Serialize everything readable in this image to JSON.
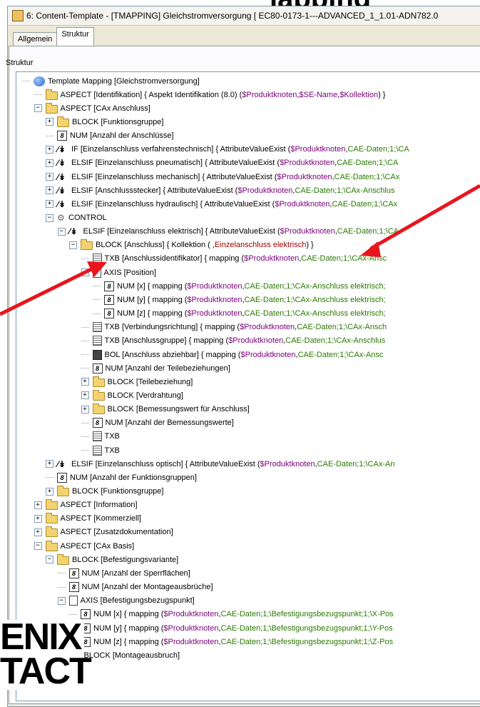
{
  "heading": "lapping",
  "window": {
    "title": "6: Content-Template - [TMAPPING] Gleichstromversorgung [ EC80-0173-1---ADVANCED_1_1.01-ADN782.0"
  },
  "tabs": [
    {
      "label": "Allgemein",
      "active": false
    },
    {
      "label": "Struktur",
      "active": true
    }
  ],
  "panel_label": "Struktur",
  "tree": [
    {
      "depth": 0,
      "exp": "",
      "icon": "tm",
      "icon_name": "template-mapping-icon",
      "text": "Template Mapping [Gleichstromversorgung]",
      "parts": []
    },
    {
      "depth": 1,
      "exp": "",
      "icon": "folder",
      "icon_name": "aspect-folder-icon",
      "text": "ASPECT [Identifikation] { Aspekt Identifikation (8.0) ( ",
      "parts": [
        [
          "$Produktknoten",
          "p"
        ],
        [
          ", ",
          "k"
        ],
        [
          "$SE-Name",
          "p"
        ],
        [
          ", ",
          "k"
        ],
        [
          "$Kollektion",
          "p"
        ],
        [
          " ) }",
          "k"
        ]
      ]
    },
    {
      "depth": 1,
      "exp": "−",
      "icon": "folder",
      "icon_name": "aspect-folder-icon",
      "text": "ASPECT [CAx Anschluss]",
      "parts": []
    },
    {
      "depth": 2,
      "exp": "+",
      "icon": "folder",
      "icon_name": "block-folder-icon",
      "text": "BLOCK [Funktionsgruppe]",
      "parts": []
    },
    {
      "depth": 2,
      "exp": "",
      "icon": "num",
      "icon_name": "num-icon",
      "text": "NUM [Anzahl der Anschlüsse]",
      "parts": []
    },
    {
      "depth": 2,
      "exp": "+",
      "icon": "cond",
      "icon_name": "condition-icon",
      "text": "IF [Einzelanschluss verfahrenstechnisch] { AttributeValueExist ( ",
      "parts": [
        [
          "$Produktknoten",
          "p"
        ],
        [
          ", ",
          "k"
        ],
        [
          "CAE-Daten;1;\\CA",
          "g"
        ]
      ]
    },
    {
      "depth": 2,
      "exp": "+",
      "icon": "cond",
      "icon_name": "condition-icon",
      "text": "ELSIF [Einzelanschluss pneumatisch] { AttributeValueExist ( ",
      "parts": [
        [
          "$Produktknoten",
          "p"
        ],
        [
          ", ",
          "k"
        ],
        [
          "CAE-Daten;1;\\CA",
          "g"
        ]
      ]
    },
    {
      "depth": 2,
      "exp": "+",
      "icon": "cond",
      "icon_name": "condition-icon",
      "text": "ELSIF [Einzelanschluss mechanisch] { AttributeValueExist ( ",
      "parts": [
        [
          "$Produktknoten",
          "p"
        ],
        [
          ", ",
          "k"
        ],
        [
          "CAE-Daten;1;\\CAx",
          "g"
        ]
      ]
    },
    {
      "depth": 2,
      "exp": "+",
      "icon": "cond",
      "icon_name": "condition-icon",
      "text": "ELSIF [Anschlussstecker] { AttributeValueExist ( ",
      "parts": [
        [
          "$Produktknoten",
          "p"
        ],
        [
          ", ",
          "k"
        ],
        [
          "CAE-Daten;1;\\CAx-Anschlus",
          "g"
        ]
      ]
    },
    {
      "depth": 2,
      "exp": "+",
      "icon": "cond",
      "icon_name": "condition-icon",
      "text": "ELSIF [Einzelanschluss hydraulisch] { AttributeValueExist ( ",
      "parts": [
        [
          "$Produktknoten",
          "p"
        ],
        [
          ", ",
          "k"
        ],
        [
          "CAE-Daten;1;\\CAx",
          "g"
        ]
      ]
    },
    {
      "depth": 2,
      "exp": "−",
      "icon": "control",
      "icon_name": "control-icon",
      "text": "CONTROL",
      "parts": []
    },
    {
      "depth": 3,
      "exp": "−",
      "icon": "cond",
      "icon_name": "condition-icon",
      "text": "ELSIF [Einzelanschluss elektrisch] { AttributeValueExist ( ",
      "parts": [
        [
          "$Produktknoten",
          "p"
        ],
        [
          ", ",
          "k"
        ],
        [
          "CAE-Daten;1;\\CA",
          "g"
        ]
      ]
    },
    {
      "depth": 4,
      "exp": "−",
      "icon": "folder",
      "icon_name": "block-folder-icon",
      "text": "BLOCK [Anschluss] { Kollektion ( , ",
      "parts": [
        [
          "Einzelanschluss elektrisch",
          "r"
        ],
        [
          " ) }",
          "k"
        ]
      ]
    },
    {
      "depth": 5,
      "exp": "",
      "icon": "txb",
      "icon_name": "txb-icon",
      "text": "TXB [Anschlussidentifikator] { mapping ( ",
      "parts": [
        [
          "$Produktknoten",
          "p"
        ],
        [
          ", ",
          "k"
        ],
        [
          "CAE-Daten;1;\\CAx-Ansc",
          "g"
        ]
      ]
    },
    {
      "depth": 5,
      "exp": "−",
      "icon": "axis",
      "icon_name": "axis-icon",
      "text": "AXIS [Position]",
      "parts": []
    },
    {
      "depth": 6,
      "exp": "",
      "icon": "num",
      "icon_name": "num-icon",
      "text": "NUM [x] { mapping ( ",
      "parts": [
        [
          "$Produktknoten",
          "p"
        ],
        [
          ", ",
          "k"
        ],
        [
          "CAE-Daten;1;\\CAx-Anschluss elektrisch;",
          "g"
        ]
      ]
    },
    {
      "depth": 6,
      "exp": "",
      "icon": "num",
      "icon_name": "num-icon",
      "text": "NUM [y] { mapping ( ",
      "parts": [
        [
          "$Produktknoten",
          "p"
        ],
        [
          ", ",
          "k"
        ],
        [
          "CAE-Daten;1;\\CAx-Anschluss elektrisch;",
          "g"
        ]
      ]
    },
    {
      "depth": 6,
      "exp": "",
      "icon": "num",
      "icon_name": "num-icon",
      "text": "NUM [z] { mapping ( ",
      "parts": [
        [
          "$Produktknoten",
          "p"
        ],
        [
          ", ",
          "k"
        ],
        [
          "CAE-Daten;1;\\CAx-Anschluss elektrisch;",
          "g"
        ]
      ]
    },
    {
      "depth": 5,
      "exp": "",
      "icon": "txb",
      "icon_name": "txb-icon",
      "text": "TXB [Verbindungsrichtung] { mapping ( ",
      "parts": [
        [
          "$Produktknoten",
          "p"
        ],
        [
          ", ",
          "k"
        ],
        [
          "CAE-Daten;1;\\CAx-Ansch",
          "g"
        ]
      ]
    },
    {
      "depth": 5,
      "exp": "",
      "icon": "txb",
      "icon_name": "txb-icon",
      "text": "TXB [Anschlussgruppe] { mapping ( ",
      "parts": [
        [
          "$Produktknoten",
          "p"
        ],
        [
          ", ",
          "k"
        ],
        [
          "CAE-Daten;1;\\CAx-Anschlus",
          "g"
        ]
      ]
    },
    {
      "depth": 5,
      "exp": "",
      "icon": "bol",
      "icon_name": "bol-icon",
      "text": "BOL [Anschluss abziehbar] { mapping ( ",
      "parts": [
        [
          "$Produktknoten",
          "p"
        ],
        [
          ", ",
          "k"
        ],
        [
          "CAE-Daten;1;\\CAx-Ansc",
          "g"
        ]
      ]
    },
    {
      "depth": 5,
      "exp": "",
      "icon": "num",
      "icon_name": "num-icon",
      "text": "NUM [Anzahl der Teilebeziehungen]",
      "parts": []
    },
    {
      "depth": 5,
      "exp": "+",
      "icon": "folder",
      "icon_name": "block-folder-icon",
      "text": "BLOCK [Teilebeziehung]",
      "parts": []
    },
    {
      "depth": 5,
      "exp": "+",
      "icon": "folder",
      "icon_name": "block-folder-icon",
      "text": "BLOCK [Verdrahtung]",
      "parts": []
    },
    {
      "depth": 5,
      "exp": "+",
      "icon": "folder",
      "icon_name": "block-folder-icon",
      "text": "BLOCK [Bemessungswert für Anschluss]",
      "parts": []
    },
    {
      "depth": 5,
      "exp": "",
      "icon": "num",
      "icon_name": "num-icon",
      "text": "NUM [Anzahl der Bemessungswerte]",
      "parts": []
    },
    {
      "depth": 5,
      "exp": "",
      "icon": "txb",
      "icon_name": "txb-icon",
      "text": "TXB",
      "parts": []
    },
    {
      "depth": 5,
      "exp": "",
      "icon": "txb",
      "icon_name": "txb-icon",
      "text": "TXB",
      "parts": []
    },
    {
      "depth": 2,
      "exp": "+",
      "icon": "cond",
      "icon_name": "condition-icon",
      "text": "ELSIF [Einzelanschluss optisch] { AttributeValueExist ( ",
      "parts": [
        [
          "$Produktknoten",
          "p"
        ],
        [
          ", ",
          "k"
        ],
        [
          "CAE-Daten;1;\\CAx-An",
          "g"
        ]
      ]
    },
    {
      "depth": 2,
      "exp": "",
      "icon": "num",
      "icon_name": "num-icon",
      "text": "NUM [Anzahl der Funktionsgruppen]",
      "parts": []
    },
    {
      "depth": 2,
      "exp": "+",
      "icon": "folder",
      "icon_name": "block-folder-icon",
      "text": "BLOCK [Funktionsgruppe]",
      "parts": []
    },
    {
      "depth": 1,
      "exp": "+",
      "icon": "folder",
      "icon_name": "aspect-folder-icon",
      "text": "ASPECT [Information]",
      "parts": []
    },
    {
      "depth": 1,
      "exp": "+",
      "icon": "folder",
      "icon_name": "aspect-folder-icon",
      "text": "ASPECT [Kommerziell]",
      "parts": []
    },
    {
      "depth": 1,
      "exp": "+",
      "icon": "folder",
      "icon_name": "aspect-folder-icon",
      "text": "ASPECT [Zusatzdokumentation]",
      "parts": []
    },
    {
      "depth": 1,
      "exp": "−",
      "icon": "folder",
      "icon_name": "aspect-folder-icon",
      "text": "ASPECT [CAx Basis]",
      "parts": []
    },
    {
      "depth": 2,
      "exp": "−",
      "icon": "folder",
      "icon_name": "block-folder-icon",
      "text": "BLOCK [Befestigungsvariante]",
      "parts": []
    },
    {
      "depth": 3,
      "exp": "",
      "icon": "num",
      "icon_name": "num-icon",
      "text": "NUM [Anzahl der Sperrflächen]",
      "parts": []
    },
    {
      "depth": 3,
      "exp": "",
      "icon": "num",
      "icon_name": "num-icon",
      "text": "NUM [Anzahl der Montageausbrüche]",
      "parts": []
    },
    {
      "depth": 3,
      "exp": "−",
      "icon": "axis",
      "icon_name": "axis-icon",
      "text": "AXIS [Befestigungsbezugspunkt]",
      "parts": []
    },
    {
      "depth": 4,
      "exp": "",
      "icon": "num",
      "icon_name": "num-icon",
      "text": "NUM [x] { mapping ( ",
      "parts": [
        [
          "$Produktknoten",
          "p"
        ],
        [
          ", ",
          "k"
        ],
        [
          "CAE-Daten;1;\\Befestigungsbezugspunkt;1;\\X-Pos",
          "g"
        ]
      ]
    },
    {
      "depth": 4,
      "exp": "",
      "icon": "num",
      "icon_name": "num-icon",
      "text": "NUM [y] { mapping ( ",
      "parts": [
        [
          "$Produktknoten",
          "p"
        ],
        [
          ", ",
          "k"
        ],
        [
          "CAE-Daten;1;\\Befestigungsbezugspunkt;1;\\Y-Pos",
          "g"
        ]
      ]
    },
    {
      "depth": 4,
      "exp": "",
      "icon": "num",
      "icon_name": "num-icon",
      "text": "NUM [z] { mapping ( ",
      "parts": [
        [
          "$Produktknoten",
          "p"
        ],
        [
          ", ",
          "k"
        ],
        [
          "CAE-Daten;1;\\Befestigungsbezugspunkt;1;\\Z-Pos",
          "g"
        ]
      ]
    },
    {
      "depth": 3,
      "exp": "+",
      "icon": "folder",
      "icon_name": "block-folder-icon",
      "text": "BLOCK [Montageausbruch]",
      "parts": []
    }
  ],
  "brand": {
    "line1": "ENIX",
    "line2": "TACT"
  },
  "colors": {
    "arrow": "#e8141e",
    "variable": "#7a007a",
    "path": "#2a7a00",
    "collection": "#a00000"
  }
}
